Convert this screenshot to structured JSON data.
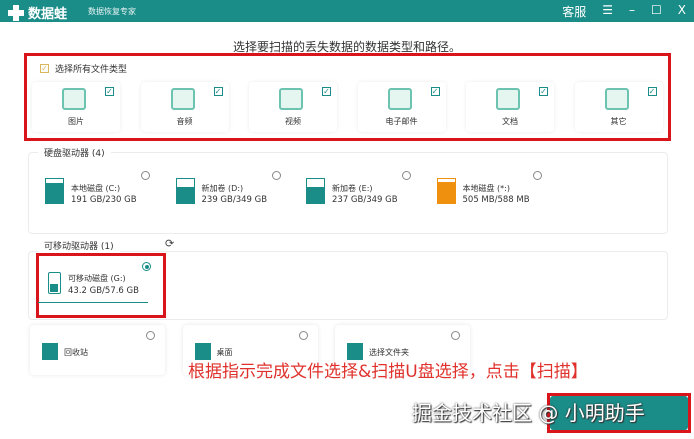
{
  "app": {
    "name": "数据蛙",
    "subtitle": "数据恢复专家",
    "support": "客服",
    "menu": "☰",
    "minimize": "–",
    "maximize": "☐",
    "close": "X"
  },
  "heading": "选择要扫描的丢失数据的数据类型和路径。",
  "file_types": {
    "select_all": "选择所有文件类型",
    "select_all_checked": true,
    "items": [
      {
        "label": "图片",
        "icon": "image-icon",
        "checked": true
      },
      {
        "label": "音频",
        "icon": "music-icon",
        "checked": true
      },
      {
        "label": "视频",
        "icon": "video-icon",
        "checked": true
      },
      {
        "label": "电子邮件",
        "icon": "email-icon",
        "checked": true
      },
      {
        "label": "文档",
        "icon": "document-icon",
        "checked": true
      },
      {
        "label": "其它",
        "icon": "other-icon",
        "checked": true
      }
    ]
  },
  "hard_drives": {
    "title": "硬盘驱动器 (4)",
    "items": [
      {
        "name": "本地磁盘 (C:)",
        "size": "191 GB/230 GB",
        "used": 0.83,
        "color": "#1b8d89"
      },
      {
        "name": "新加卷 (D:)",
        "size": "239 GB/349 GB",
        "used": 0.68,
        "color": "#1b8d89"
      },
      {
        "name": "新加卷 (E:)",
        "size": "237 GB/349 GB",
        "used": 0.68,
        "color": "#1b8d89"
      },
      {
        "name": "本地磁盘 (*:)",
        "size": "505 MB/588 MB",
        "used": 0.86,
        "color": "#f0900f"
      }
    ]
  },
  "removable": {
    "title": "可移动驱动器 (1)",
    "items": [
      {
        "name": "可移动磁盘 (G:)",
        "size": "43.2 GB/57.6 GB",
        "selected": true
      }
    ]
  },
  "locations": [
    {
      "label": "回收站",
      "icon": "trash-icon"
    },
    {
      "label": "桌面",
      "icon": "desktop-icon"
    },
    {
      "label": "选择文件夹",
      "icon": "folder-icon"
    }
  ],
  "annotation": "根据指示完成文件选择&扫描U盘选择，点击【扫描】",
  "watermark": "掘金技术社区 @ 小明助手",
  "colors": {
    "accent": "#1b8d89",
    "highlight": "#d9141b"
  }
}
